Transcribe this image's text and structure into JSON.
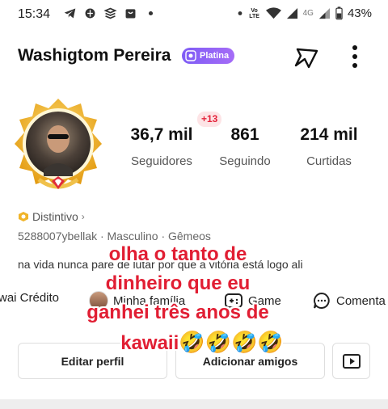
{
  "status_bar": {
    "time": "15:34",
    "network_label": "4G",
    "volte": "Vo LTE",
    "battery": "43%"
  },
  "profile": {
    "name": "Washigtom Pereira",
    "badge": "Platina",
    "stats": [
      {
        "value": "36,7 mil",
        "label": "Seguidores"
      },
      {
        "value": "861",
        "label": "Seguindo"
      },
      {
        "value": "214 mil",
        "label": "Curtidas"
      }
    ],
    "new_count": "+13",
    "distintivo": "Distintivo",
    "meta": "5288007ybellak · Masculino · Gêmeos",
    "bio": "na vida nunca pare de lutar por que a vitória está logo ali"
  },
  "shortcuts": [
    {
      "label": "wai Crédito"
    },
    {
      "label": "Minha família"
    },
    {
      "label": "Game"
    },
    {
      "label": "Comenta"
    }
  ],
  "buttons": {
    "edit": "Editar perfil",
    "add_friends": "Adicionar amigos"
  },
  "caption": {
    "line1": "olha o tanto de",
    "line2": "dinheiro que eu",
    "line3": "ganhei três anos de",
    "line4": "kawaii",
    "emojis": "🤣🤣🤣🤣"
  },
  "colors": {
    "accent_red": "#e11e33",
    "badge_purple": "#8a60f6",
    "avatar_gold": "#f2b01e"
  },
  "icons": {
    "share": "share-arrow-icon",
    "more": "more-vertical-icon",
    "game": "gamepad-icon",
    "comment": "comment-bubble-icon",
    "video": "video-play-icon"
  }
}
